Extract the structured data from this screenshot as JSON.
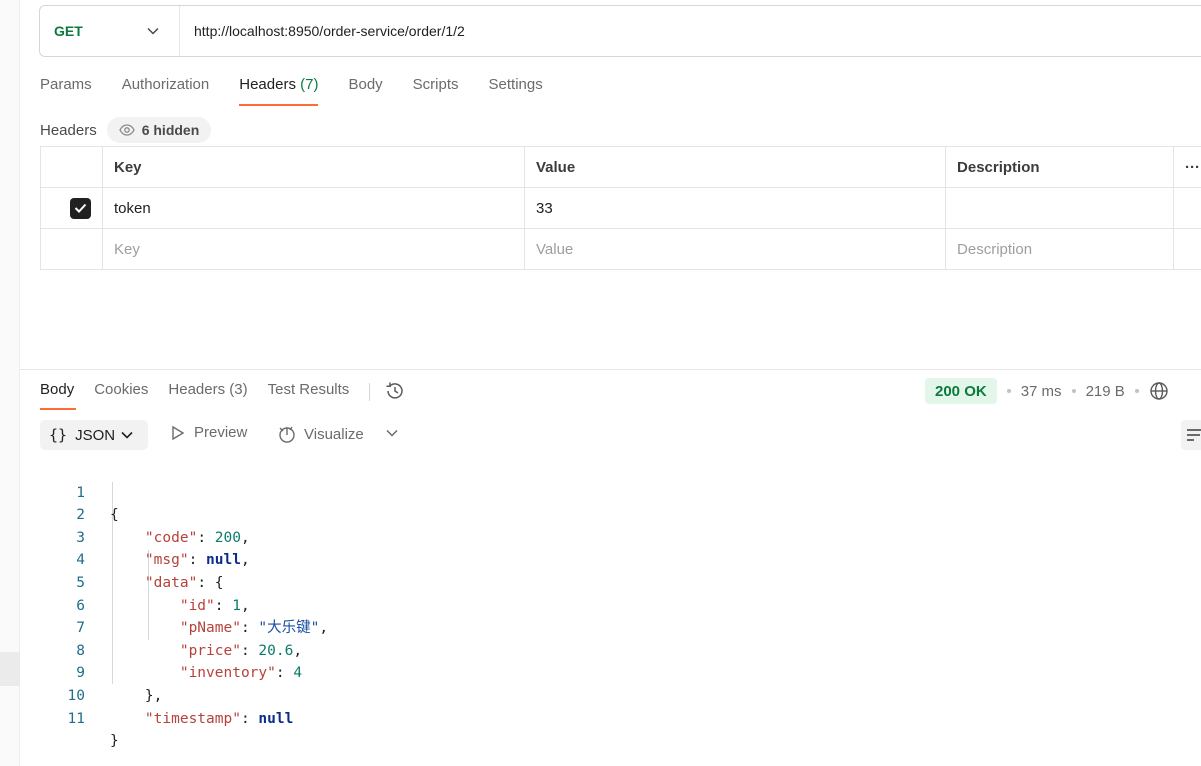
{
  "request": {
    "method": "GET",
    "url": "http://localhost:8950/order-service/order/1/2"
  },
  "request_tabs": {
    "params": "Params",
    "authorization": "Authorization",
    "headers": "Headers",
    "headers_count": "(7)",
    "body": "Body",
    "scripts": "Scripts",
    "settings": "Settings"
  },
  "headers_section": {
    "title": "Headers",
    "hidden_label": "6 hidden",
    "columns": {
      "key": "Key",
      "value": "Value",
      "description": "Description",
      "more": "···"
    },
    "rows": [
      {
        "checked": true,
        "key": "token",
        "value": "33",
        "description": ""
      }
    ],
    "placeholders": {
      "key": "Key",
      "value": "Value",
      "description": "Description"
    }
  },
  "response_tabs": {
    "body": "Body",
    "cookies": "Cookies",
    "headers": "Headers (3)",
    "test_results": "Test Results"
  },
  "response_meta": {
    "status": "200 OK",
    "time": "37 ms",
    "size": "219 B"
  },
  "response_toolbar": {
    "format_icon": "{}",
    "format": "JSON",
    "preview": "Preview",
    "visualize": "Visualize"
  },
  "response_body": {
    "line_numbers": [
      "1",
      "2",
      "3",
      "4",
      "5",
      "6",
      "7",
      "8",
      "9",
      "10",
      "11"
    ],
    "code": {
      "key_code": "\"code\"",
      "val_code": "200",
      "key_msg": "\"msg\"",
      "val_msg": "null",
      "key_data": "\"data\"",
      "key_id": "\"id\"",
      "val_id": "1",
      "key_pname": "\"pName\"",
      "val_pname": "\"大乐键\"",
      "key_price": "\"price\"",
      "val_price": "20.6",
      "key_inventory": "\"inventory\"",
      "val_inventory": "4",
      "key_timestamp": "\"timestamp\"",
      "val_timestamp": "null"
    }
  },
  "colors": {
    "accent": "#ff6c37",
    "method_get": "#0c7a3f",
    "status_ok_bg": "#e2f6e9"
  }
}
